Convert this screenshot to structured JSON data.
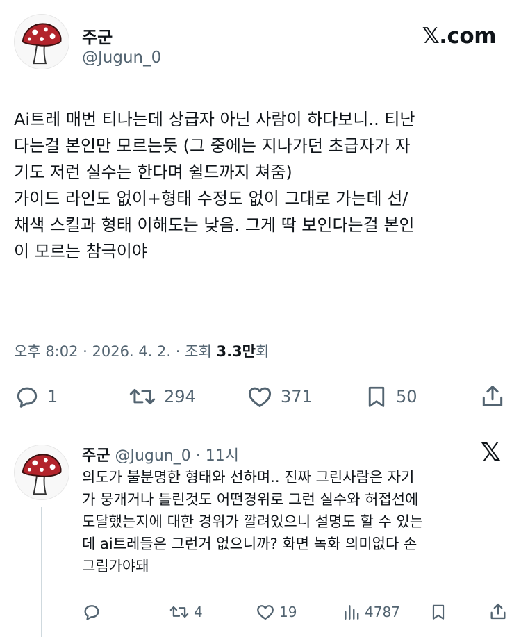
{
  "main_tweet": {
    "display_name": "주군",
    "handle": "@Jugun_0",
    "source_logo": "𝕏.com",
    "text_lines": [
      "Ai트레 매번 티나는데 상급자 아닌 사람이 하다보니.. 티난",
      "다는걸 본인만 모르는듯 (그 중에는 지나가던 초급자가 자",
      "기도 저런 실수는 한다며 쉴드까지 쳐줌)",
      "가이드 라인도 없이+형태 수정도 없이 그대로 가는데 선/",
      "채색 스킬과 형태 이해도는 낮음. 그게 딱 보인다는걸 본인",
      "이 모르는 참극이야"
    ],
    "meta": {
      "time": "오후 8:02",
      "sep1": "·",
      "date": "2026. 4. 2.",
      "sep2": "·",
      "views_label": "조회",
      "views_value": "3.3만",
      "views_suffix": "회"
    },
    "actions": {
      "replies": "1",
      "retweets": "294",
      "likes": "371",
      "bookmarks": "50"
    },
    "icons": [
      "reply-icon",
      "retweet-icon",
      "like-icon",
      "bookmark-icon",
      "share-icon"
    ]
  },
  "reply_tweet": {
    "display_name": "주군",
    "handle": "@Jugun_0",
    "sep": "·",
    "time": "11시",
    "text_lines": [
      "의도가 불분명한 형태와 선하며.. 진짜 그린사람은 자기",
      "가 뭉개거나 틀린것도 어떤경위로 그런 실수와 허접선에",
      "도달했는지에 대한 경위가 깔려있으니 설명도 할 수 있는",
      "데 ai트레들은 그런거 없으니까? 화면 녹화 의미없다 손",
      "그림가야돼"
    ],
    "actions": {
      "replies": "",
      "retweets": "4",
      "likes": "19",
      "views": "4787",
      "bookmarks": ""
    }
  },
  "colors": {
    "text": "#0f1419",
    "secondary": "#536471",
    "divider": "#e6e9ec",
    "avatar_cap": "#b3242c"
  }
}
